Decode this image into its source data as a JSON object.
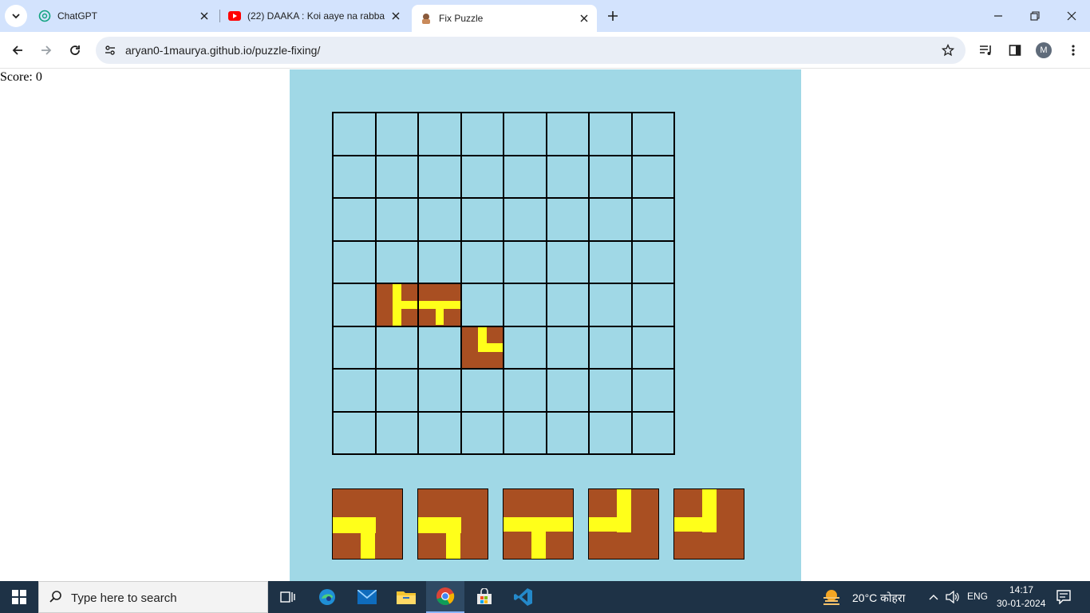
{
  "browser": {
    "tabs": [
      {
        "title": "ChatGPT",
        "icon": "chatgpt-icon"
      },
      {
        "title": "(22) DAAKA : Koi aaye na rabba",
        "icon": "youtube-icon"
      },
      {
        "title": "Fix Puzzle",
        "icon": "puzzle-site-icon",
        "active": true
      }
    ],
    "url": "aryan0-1maurya.github.io/puzzle-fixing/",
    "profile_initial": "M"
  },
  "page": {
    "score_text": "Score: 0"
  },
  "puzzle": {
    "grid_size": 8,
    "placed_tiles": [
      {
        "row": 4,
        "col": 1,
        "shape": "left-vertical-with-right-stub"
      },
      {
        "row": 4,
        "col": 2,
        "shape": "tee-top"
      },
      {
        "row": 5,
        "col": 3,
        "shape": "corner-top-right"
      }
    ],
    "available_pieces": [
      {
        "shape": "corner-left-down"
      },
      {
        "shape": "corner-left-down"
      },
      {
        "shape": "tee-down"
      },
      {
        "shape": "corner-up-left"
      },
      {
        "shape": "corner-up-left"
      }
    ],
    "colors": {
      "board": "#a0d8e6",
      "tile": "#a94f22",
      "pipe": "#ffff1a"
    }
  },
  "taskbar": {
    "search_placeholder": "Type here to search",
    "weather": "20°C कोहरा",
    "language": "ENG",
    "time": "14:17",
    "date": "30-01-2024"
  }
}
